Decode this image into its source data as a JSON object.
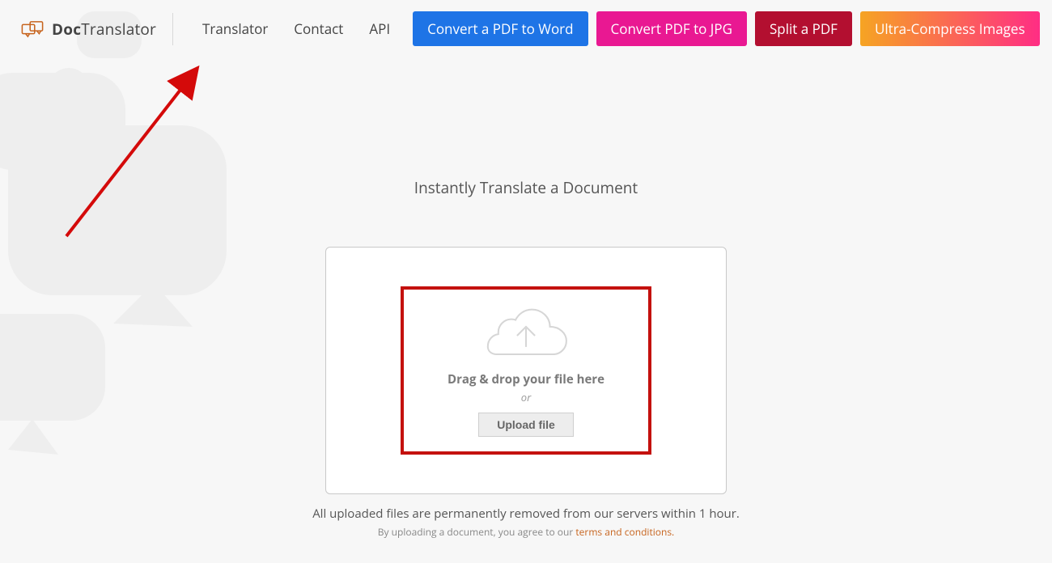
{
  "logo": {
    "bold": "Doc",
    "rest": "Translator"
  },
  "nav": {
    "translator": "Translator",
    "contact": "Contact",
    "api": "API"
  },
  "buttons": {
    "pdf_to_word": "Convert a PDF to Word",
    "pdf_to_jpg": "Convert PDF to JPG",
    "split_pdf": "Split a PDF",
    "ultra_compress": "Ultra-Compress Images"
  },
  "main": {
    "headline": "Instantly Translate a Document",
    "drag_text": "Drag & drop your file here",
    "or_text": "or",
    "upload_btn": "Upload file",
    "note1": "All uploaded files are permanently removed from our servers within 1 hour.",
    "note2_prefix": "By uploading a document, you agree to our ",
    "note2_link": "terms and conditions."
  }
}
